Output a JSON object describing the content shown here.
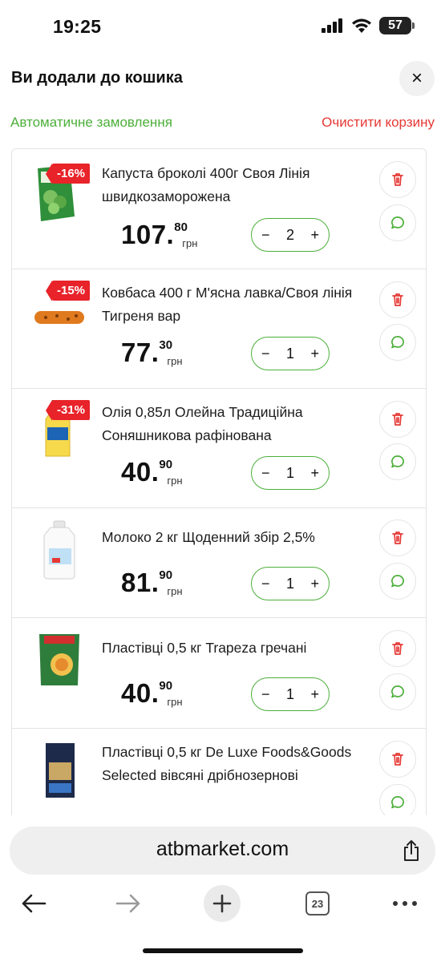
{
  "status": {
    "time": "19:25",
    "battery": "57"
  },
  "sheet": {
    "title": "Ви додали до кошика",
    "auto_order": "Автоматичне замовлення",
    "clear_cart": "Очистити корзину"
  },
  "items": [
    {
      "name": "Капуста броколі 400г Своя Лінія швидкозаморожена",
      "discount": "-16%",
      "price_int": "107.",
      "price_frac": "80",
      "currency": "грн",
      "qty": "2",
      "image": "broccoli-pack"
    },
    {
      "name": "Ковбаса 400 г М'ясна лавка/Своя лінія Тигреня вар",
      "discount": "-15%",
      "price_int": "77.",
      "price_frac": "30",
      "currency": "грн",
      "qty": "1",
      "image": "sausage"
    },
    {
      "name": "Олія 0,85л Олейна Традиційна Соняшникова рафінована",
      "discount": "-31%",
      "price_int": "40.",
      "price_frac": "90",
      "currency": "грн",
      "qty": "1",
      "image": "oil-bottle"
    },
    {
      "name": "Молоко 2 кг Щоденний збір 2,5%",
      "discount": "",
      "price_int": "81.",
      "price_frac": "90",
      "currency": "грн",
      "qty": "1",
      "image": "milk-bottle"
    },
    {
      "name": "Пластівці 0,5 кг Trapeza гречані",
      "discount": "",
      "price_int": "40.",
      "price_frac": "90",
      "currency": "грн",
      "qty": "1",
      "image": "buckwheat-flakes"
    },
    {
      "name": "Пластівці 0,5 кг De Luxe Foods&Goods Selected вівсяні дрібнозернові",
      "discount": "",
      "price_int": "",
      "price_frac": "",
      "currency": "",
      "qty": "",
      "image": "oat-flakes"
    }
  ],
  "controls": {
    "minus": "−",
    "plus": "+",
    "close": "×"
  },
  "browser": {
    "url": "atbmarket.com",
    "tabs_count": "23"
  },
  "colors": {
    "green": "#4caf3a",
    "red": "#e53935",
    "badge": "#e8232a"
  }
}
